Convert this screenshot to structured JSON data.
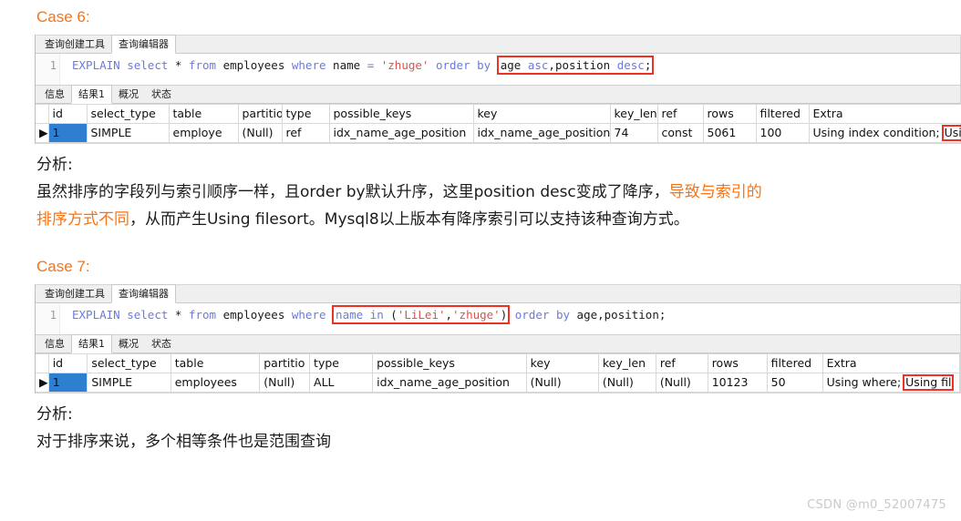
{
  "case6": {
    "heading": "Case 6:",
    "editor": {
      "tabs": [
        {
          "label": "查询创建工具",
          "active": false
        },
        {
          "label": "查询编辑器",
          "active": true
        }
      ],
      "line_number": "1",
      "sql_tokens": [
        {
          "text": "EXPLAIN",
          "cls": "kw"
        },
        {
          "text": " ",
          "cls": "plain"
        },
        {
          "text": "select",
          "cls": "kw"
        },
        {
          "text": " ",
          "cls": "plain"
        },
        {
          "text": "*",
          "cls": "id"
        },
        {
          "text": " ",
          "cls": "plain"
        },
        {
          "text": "from",
          "cls": "kw"
        },
        {
          "text": " ",
          "cls": "plain"
        },
        {
          "text": "employees",
          "cls": "id"
        },
        {
          "text": " ",
          "cls": "plain"
        },
        {
          "text": "where",
          "cls": "kw"
        },
        {
          "text": " ",
          "cls": "plain"
        },
        {
          "text": "name",
          "cls": "id"
        },
        {
          "text": " ",
          "cls": "plain"
        },
        {
          "text": "=",
          "cls": "kw"
        },
        {
          "text": " ",
          "cls": "plain"
        },
        {
          "text": "'zhuge'",
          "cls": "str"
        },
        {
          "text": " ",
          "cls": "plain"
        },
        {
          "text": "order",
          "cls": "kw"
        },
        {
          "text": " ",
          "cls": "plain"
        },
        {
          "text": "by",
          "cls": "kw"
        },
        {
          "text": " ",
          "cls": "plain"
        }
      ],
      "sql_highlight_tokens": [
        {
          "text": "age",
          "cls": "id"
        },
        {
          "text": " ",
          "cls": "plain"
        },
        {
          "text": "asc",
          "cls": "kw"
        },
        {
          "text": ",",
          "cls": "id"
        },
        {
          "text": "position",
          "cls": "id"
        },
        {
          "text": " ",
          "cls": "plain"
        },
        {
          "text": "desc",
          "cls": "kw"
        },
        {
          "text": ";",
          "cls": "id"
        }
      ]
    },
    "result_tabs": [
      {
        "label": "信息",
        "active": false
      },
      {
        "label": "结果1",
        "active": true
      },
      {
        "label": "概况",
        "active": false
      },
      {
        "label": "状态",
        "active": false
      }
    ],
    "table": {
      "columns": [
        "id",
        "select_type",
        "table",
        "partitio",
        "type",
        "possible_keys",
        "key",
        "key_len",
        "ref",
        "rows",
        "filtered",
        "Extra"
      ],
      "rows": [
        {
          "marker": "▶",
          "cells": [
            {
              "value": "1",
              "style": "selected"
            },
            {
              "value": "SIMPLE",
              "style": "normal"
            },
            {
              "value": "employe",
              "style": "normal"
            },
            {
              "value": "(Null)",
              "style": "null"
            },
            {
              "value": "ref",
              "style": "normal"
            },
            {
              "value": "idx_name_age_position",
              "style": "normal"
            },
            {
              "value": "idx_name_age_position",
              "style": "normal"
            },
            {
              "value": "74",
              "style": "normal"
            },
            {
              "value": "const",
              "style": "normal"
            },
            {
              "value": "5061",
              "style": "normal"
            },
            {
              "value": "100",
              "style": "number"
            },
            {
              "value": "Using index condition;",
              "style": "normal",
              "boxed_suffix": "Using"
            }
          ]
        }
      ]
    },
    "analysis": {
      "label": "分析:",
      "lines": [
        [
          {
            "text": "虽然排序的字段列与索引顺序一样，且order by默认升序，这里position desc变成了降序，",
            "color": "normal"
          },
          {
            "text": "导致与索引的",
            "color": "orange"
          }
        ],
        [
          {
            "text": "排序方式不同",
            "color": "orange"
          },
          {
            "text": "，从而产生Using filesort。Mysql8以上版本有降序索引可以支持该种查询方式。",
            "color": "normal"
          }
        ]
      ]
    }
  },
  "case7": {
    "heading": "Case 7:",
    "editor": {
      "tabs": [
        {
          "label": "查询创建工具",
          "active": false
        },
        {
          "label": "查询编辑器",
          "active": true
        }
      ],
      "line_number": "1",
      "sql_tokens": [
        {
          "text": "EXPLAIN",
          "cls": "kw"
        },
        {
          "text": " ",
          "cls": "plain"
        },
        {
          "text": "select",
          "cls": "kw"
        },
        {
          "text": " ",
          "cls": "plain"
        },
        {
          "text": "*",
          "cls": "id"
        },
        {
          "text": " ",
          "cls": "plain"
        },
        {
          "text": "from",
          "cls": "kw"
        },
        {
          "text": " ",
          "cls": "plain"
        },
        {
          "text": "employees",
          "cls": "id"
        },
        {
          "text": " ",
          "cls": "plain"
        },
        {
          "text": "where",
          "cls": "kw"
        },
        {
          "text": " ",
          "cls": "plain"
        }
      ],
      "sql_highlight_tokens": [
        {
          "text": "name",
          "cls": "kw"
        },
        {
          "text": " ",
          "cls": "plain"
        },
        {
          "text": "in",
          "cls": "kw"
        },
        {
          "text": " ",
          "cls": "plain"
        },
        {
          "text": "(",
          "cls": "id"
        },
        {
          "text": "'LiLei'",
          "cls": "str"
        },
        {
          "text": ",",
          "cls": "id"
        },
        {
          "text": "'zhuge'",
          "cls": "str"
        },
        {
          "text": ")",
          "cls": "id"
        }
      ],
      "sql_tail_tokens": [
        {
          "text": " ",
          "cls": "plain"
        },
        {
          "text": "order",
          "cls": "kw"
        },
        {
          "text": " ",
          "cls": "plain"
        },
        {
          "text": "by",
          "cls": "kw"
        },
        {
          "text": " ",
          "cls": "plain"
        },
        {
          "text": "age",
          "cls": "id"
        },
        {
          "text": ",",
          "cls": "id"
        },
        {
          "text": "position",
          "cls": "id"
        },
        {
          "text": ";",
          "cls": "id"
        }
      ]
    },
    "result_tabs": [
      {
        "label": "信息",
        "active": false
      },
      {
        "label": "结果1",
        "active": true
      },
      {
        "label": "概况",
        "active": false
      },
      {
        "label": "状态",
        "active": false
      }
    ],
    "table": {
      "columns": [
        "id",
        "select_type",
        "table",
        "partitio",
        "type",
        "possible_keys",
        "key",
        "key_len",
        "ref",
        "rows",
        "filtered",
        "Extra"
      ],
      "rows": [
        {
          "marker": "▶",
          "cells": [
            {
              "value": "1",
              "style": "selected"
            },
            {
              "value": "SIMPLE",
              "style": "normal"
            },
            {
              "value": "employees",
              "style": "normal"
            },
            {
              "value": "(Null)",
              "style": "null"
            },
            {
              "value": "ALL",
              "style": "normal"
            },
            {
              "value": "idx_name_age_position",
              "style": "normal"
            },
            {
              "value": "(Null)",
              "style": "null"
            },
            {
              "value": "(Null)",
              "style": "null"
            },
            {
              "value": "(Null)",
              "style": "null"
            },
            {
              "value": "10123",
              "style": "normal"
            },
            {
              "value": "50",
              "style": "number"
            },
            {
              "value": "Using where;",
              "style": "normal",
              "boxed_suffix": "Using fil"
            }
          ]
        }
      ]
    },
    "analysis": {
      "label": "分析:",
      "lines": [
        [
          {
            "text": "对于排序来说，多个相等条件也是范围查询",
            "color": "normal"
          }
        ]
      ]
    }
  },
  "watermark": "CSDN @m0_52007475",
  "colors": {
    "accent_orange": "#f97316",
    "highlight_box": "#ee3124",
    "sql_keyword": "#6a7ae0",
    "sql_string": "#d9534f",
    "selected_cell": "#2f7fd1",
    "id_header": "#dbe8f7"
  }
}
